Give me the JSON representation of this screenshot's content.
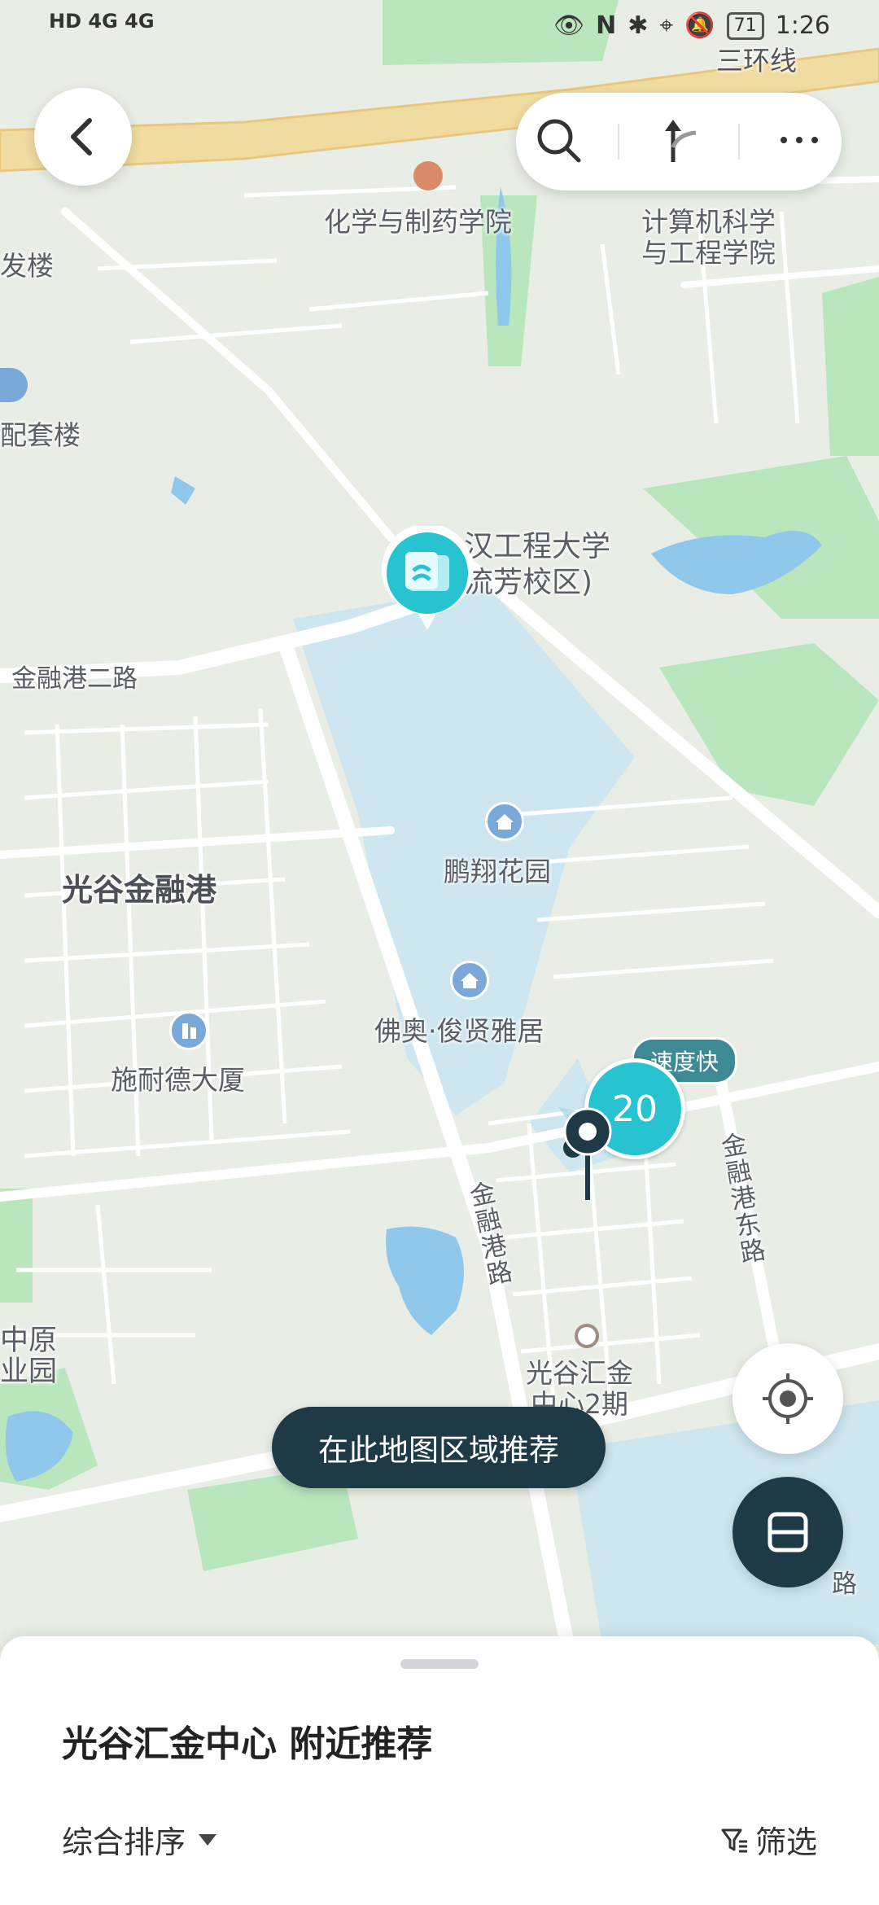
{
  "status_bar": {
    "network": "HD 4G 4G",
    "battery": "71",
    "time": "1:26"
  },
  "map": {
    "labels": {
      "ring_road": "三环线",
      "chem_school": "化学与制药学院",
      "cs_school": "计算机科学\n与工程学院",
      "fa_lou": "发楼",
      "peitao_lou": "配套楼",
      "wuhan_univ": "汉工程大学\n流芳校区)",
      "jinronggang_2": "金融港二路",
      "guanggu_jrg": "光谷金融港",
      "pengxiang": "鹏翔花园",
      "foao": "佛奥·俊贤雅居",
      "shinaide": "施耐德大厦",
      "jinronggang_road": "金融港路",
      "jinronggang_east": "金融港东路",
      "zhongyuan": "中原\n业园",
      "huijin_2": "光谷汇金\n中心2期",
      "lu": "路"
    },
    "cluster": {
      "count": "20",
      "tag": "速度快"
    }
  },
  "controls": {
    "back_icon": "chevron-left-icon",
    "search_icon": "search-icon",
    "route_icon": "route-icon",
    "more_icon": "more-icon",
    "locate_icon": "locate-icon",
    "scan_icon": "scan-icon"
  },
  "recommend_button": "在此地图区域推荐",
  "sheet": {
    "title": "光谷汇金中心 附近推荐",
    "sort_label": "综合排序",
    "filter_label": "筛选"
  },
  "colors": {
    "map_bg": "#e8eee6",
    "green": "#b9e6bd",
    "water": "#cde6f0",
    "road": "#ffffff",
    "highway": "#f0dca0",
    "accent": "#27c3d1",
    "dark": "#1f3a47"
  }
}
